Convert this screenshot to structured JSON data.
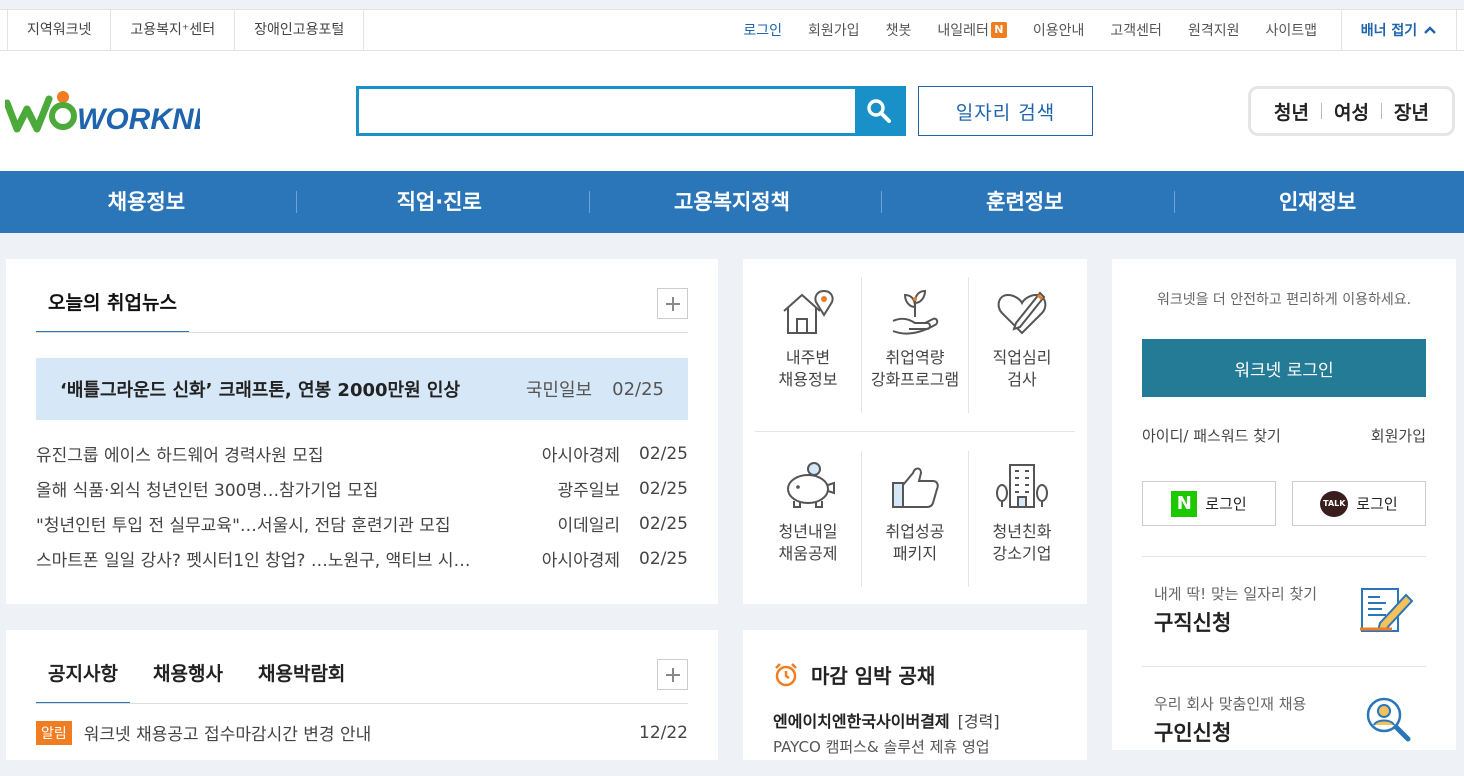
{
  "topbar": {
    "left_links": [
      "지역워크넷",
      "고용복지⁺센터",
      "장애인고용포털"
    ],
    "right_links": [
      "로그인",
      "회원가입",
      "챗봇",
      "내일레터",
      "이용안내",
      "고객센터",
      "원격지원",
      "사이트맵"
    ],
    "new_badge": "N",
    "banner_toggle": "배너 접기"
  },
  "header": {
    "logo_text": "WORKNET",
    "search_placeholder": "",
    "job_search_label": "일자리 검색",
    "targets": [
      "청년",
      "여성",
      "장년"
    ]
  },
  "gnb": [
    "채용정보",
    "직업·진로",
    "고용복지정책",
    "훈련정보",
    "인재정보"
  ],
  "news": {
    "tab": "오늘의 취업뉴스",
    "headline": {
      "title": "‘배틀그라운드 신화’ 크래프톤, 연봉 2000만원 인상",
      "source": "국민일보",
      "date": "02/25"
    },
    "items": [
      {
        "title": "유진그룹 에이스 하드웨어 경력사원 모집",
        "source": "아시아경제",
        "date": "02/25"
      },
      {
        "title": "올해 식품·외식 청년인턴 300명…참가기업 모집",
        "source": "광주일보",
        "date": "02/25"
      },
      {
        "title": "\"청년인턴 투입 전 실무교육\"…서울시, 전담 훈련기관 모집",
        "source": "이데일리",
        "date": "02/25"
      },
      {
        "title": "스마트폰 일일 강사? 펫시터1인 창업? …노원구, 액티브 시…",
        "source": "아시아경제",
        "date": "02/25"
      }
    ]
  },
  "services": [
    {
      "line1": "내주변",
      "line2": "채용정보",
      "icon": "house-pin-icon"
    },
    {
      "line1": "취업역량",
      "line2": "강화프로그램",
      "icon": "sprout-hand-icon"
    },
    {
      "line1": "직업심리",
      "line2": "검사",
      "icon": "heart-pen-icon"
    },
    {
      "line1": "청년내일",
      "line2": "채움공제",
      "icon": "piggy-bank-icon"
    },
    {
      "line1": "취업성공",
      "line2": "패키지",
      "icon": "thumbs-up-icon"
    },
    {
      "line1": "청년친화",
      "line2": "강소기업",
      "icon": "building-icon"
    }
  ],
  "login": {
    "message": "워크넷을 더 안전하고 편리하게 이용하세요.",
    "button": "워크넷 로그인",
    "find": "아이디/ 패스워드 찾기",
    "join": "회원가입",
    "naver_logo": "N",
    "naver": "로그인",
    "kakao_logo": "TALK",
    "kakao": "로그인",
    "quick": [
      {
        "sub": "내게 딱! 맞는 일자리 찾기",
        "title": "구직신청"
      },
      {
        "sub": "우리 회사 맞춤인재 채용",
        "title": "구인신청"
      }
    ]
  },
  "notice": {
    "tabs": [
      "공지사항",
      "채용행사",
      "채용박람회"
    ],
    "tag": "알림",
    "row": {
      "title": "워크넷 채용공고 접수마감시간 변경 안내",
      "date": "12/22"
    }
  },
  "deadline": {
    "title": "마감 임박 공채",
    "company": "엔에이치엔한국사이버결제",
    "type": "[경력]",
    "sub": "PAYCO 캠퍼스& 솔루션 제휴 영업"
  },
  "colors": {
    "primary": "#2b76b9",
    "search": "#1a90c9",
    "login": "#247b96",
    "accent": "#f07d21",
    "headline_bg": "#d6e8f7"
  }
}
